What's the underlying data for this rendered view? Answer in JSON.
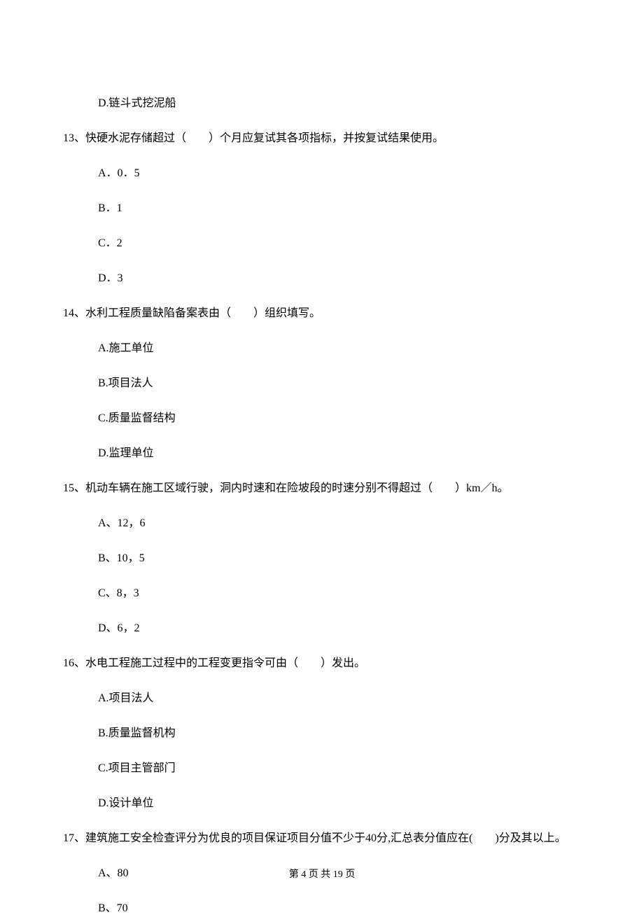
{
  "options_prev": {
    "d": "D.链斗式挖泥船"
  },
  "q13": {
    "text": "13、快硬水泥存储超过（　　）个月应复试其各项指标，并按复试结果使用。",
    "a": "A．0．5",
    "b": "B．1",
    "c": "C．2",
    "d": "D．3"
  },
  "q14": {
    "text": "14、水利工程质量缺陷备案表由（　　）组织填写。",
    "a": "A.施工单位",
    "b": "B.项目法人",
    "c": "C.质量监督结构",
    "d": "D.监理单位"
  },
  "q15": {
    "text": "15、机动车辆在施工区域行驶，洞内时速和在险坡段的时速分别不得超过（　　）km／h。",
    "a": "A、12，6",
    "b": "B、10，5",
    "c": "C、8，3",
    "d": "D、6，2"
  },
  "q16": {
    "text": "16、水电工程施工过程中的工程变更指令可由（　　）发出。",
    "a": "A.项目法人",
    "b": "B.质量监督机构",
    "c": "C.项目主管部门",
    "d": "D.设计单位"
  },
  "q17": {
    "text1": "17、建筑施工安全检查评分为优良的项目保证项目分值不少于40分,汇总表分值应在(　　)分及其以上。",
    "a": "A、80",
    "b": "B、70"
  },
  "footer": "第 4 页 共 19 页"
}
